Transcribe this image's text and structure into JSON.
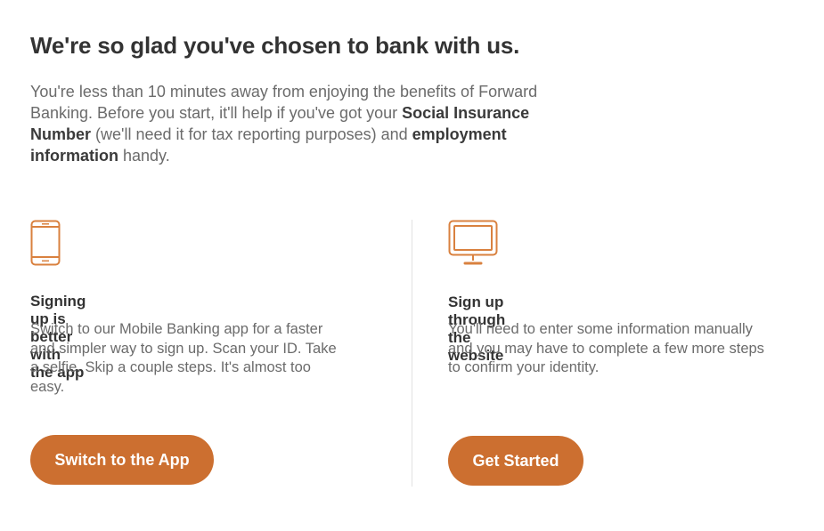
{
  "header": {
    "title": "We're so glad you've chosen to bank with us.",
    "intro_part1": "You're less than 10 minutes away from enjoying the benefits of Forward Banking. Before you start, it'll help if you've got your ",
    "intro_bold1": "Social Insurance Number",
    "intro_part2": " (we'll need it for tax reporting purposes) and ",
    "intro_bold2": "employment information",
    "intro_part3": " handy."
  },
  "app_option": {
    "icon": "mobile-phone-icon",
    "heading": "Signing up is better with the app",
    "description": "Switch to our Mobile Banking app for a faster and simpler way to sign up. Scan your ID. Take a selfie. Skip a couple steps. It's almost too easy.",
    "button_label": "Switch to the App"
  },
  "web_option": {
    "icon": "desktop-monitor-icon",
    "heading": "Sign up through the website",
    "description": "You'll need to enter some information manually and you may have to complete a few more steps to confirm your identity.",
    "button_label": "Get Started"
  },
  "colors": {
    "accent": "#cc6f30",
    "icon": "#d9813f",
    "heading_text": "#333333",
    "body_text": "#6b6b6b",
    "divider": "#e2e2e2"
  }
}
